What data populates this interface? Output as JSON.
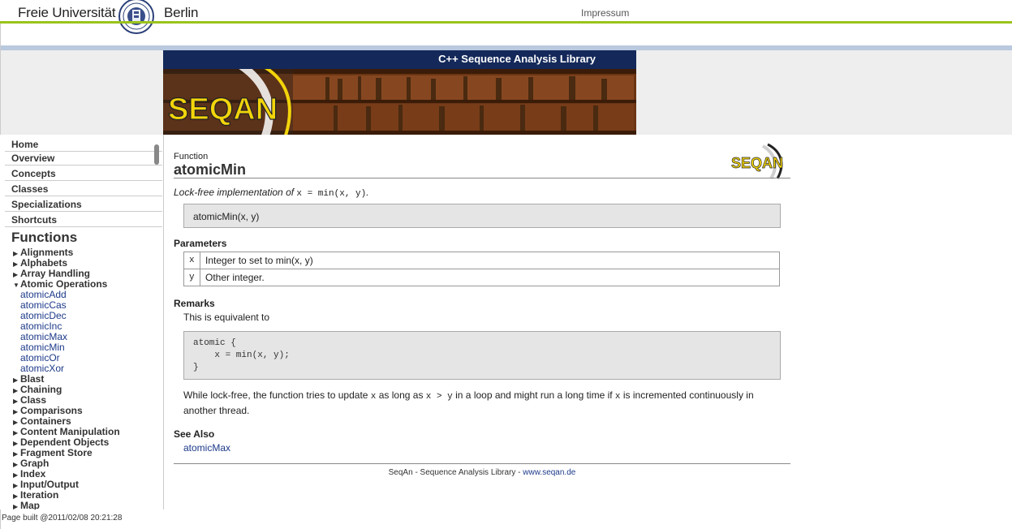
{
  "header": {
    "university_left": "Freie Universität",
    "university_right": "Berlin",
    "impressum": "Impressum"
  },
  "banner": {
    "title": "C++ Sequence Analysis Library",
    "logo_text": "SEQAN"
  },
  "sidebar": {
    "nav": [
      "Home",
      "Overview",
      "Concepts",
      "Classes",
      "Specializations",
      "Shortcuts"
    ],
    "functions_heading": "Functions",
    "categories_before": [
      "Alignments",
      "Alphabets",
      "Array Handling"
    ],
    "expanded_category": "Atomic Operations",
    "expanded_items": [
      "atomicAdd",
      "atomicCas",
      "atomicDec",
      "atomicInc",
      "atomicMax",
      "atomicMin",
      "atomicOr",
      "atomicXor"
    ],
    "categories_after": [
      "Blast",
      "Chaining",
      "Class",
      "Comparisons",
      "Containers",
      "Content Manipulation",
      "Dependent Objects",
      "Fragment Store",
      "Graph",
      "Index",
      "Input/Output",
      "Iteration",
      "Map"
    ]
  },
  "page_built": "Page built @2011/02/08 20:21:28",
  "content": {
    "kind": "Function",
    "title": "atomicMin",
    "logo_text": "SEQAN",
    "summary_text": "Lock-free implementation of ",
    "summary_code": "x = min(x, y)",
    "summary_end": ".",
    "signature": "atomicMin(x, y)",
    "parameters_heading": "Parameters",
    "parameters": [
      {
        "name": "x",
        "desc": "Integer to set to min(x, y)"
      },
      {
        "name": "y",
        "desc": "Other integer."
      }
    ],
    "remarks_heading": "Remarks",
    "remarks_intro": "This is equivalent to",
    "code_block": "atomic {\n    x = min(x, y);\n}",
    "para_1": "While lock-free, the function tries to update ",
    "para_code_1": "x",
    "para_2": " as long as ",
    "para_code_2": "x > y",
    "para_3": " in a loop and might run a long time if ",
    "para_code_3": "x",
    "para_4": " is incremented continuously in another thread.",
    "see_also_heading": "See Also",
    "see_also_link": "atomicMax",
    "footer_text": "SeqAn - Sequence Analysis Library - ",
    "footer_link": "www.seqan.de"
  },
  "colors": {
    "fu_green": "#9ac31c",
    "banner_navy": "#14295a",
    "link_blue": "#1d3a8a",
    "seqan_yellow": "#f2d40b"
  }
}
